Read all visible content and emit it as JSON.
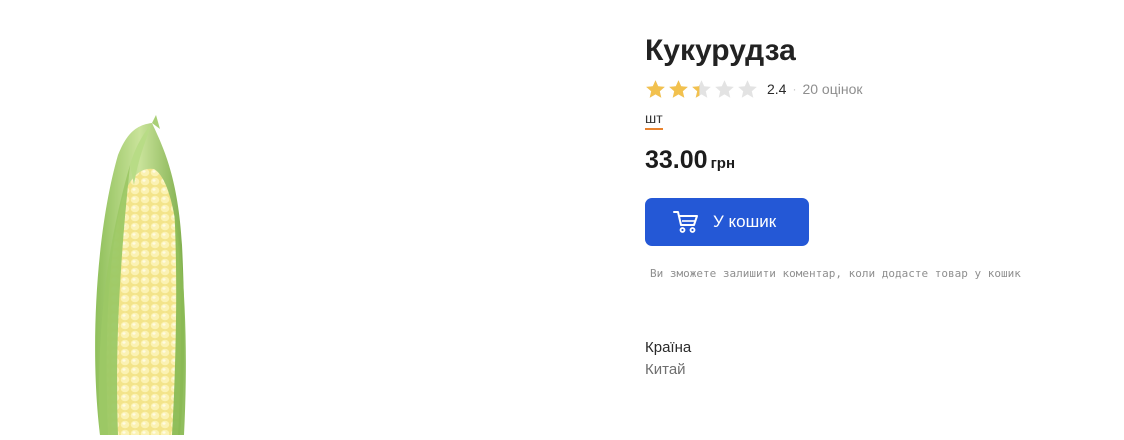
{
  "product": {
    "title": "Кукурудза",
    "image_icon": "corn-cob-image",
    "rating": {
      "value": "2.4",
      "stars_filled": 2.4,
      "stars_total": 5,
      "separator": "·",
      "count_label": "20 оцінок",
      "star_color": "#f2c14e",
      "star_empty_color": "#e3e3e3"
    },
    "unit": "шт",
    "price": {
      "value": "33.00",
      "currency": "грн"
    },
    "cart_button": {
      "label": "У кошик",
      "icon": "cart-icon",
      "color": "#2458d6"
    },
    "hint": "Ви зможете залишити коментар, коли додасте товар у кошик",
    "specs": [
      {
        "label": "Країна",
        "value": "Китай"
      }
    ]
  }
}
